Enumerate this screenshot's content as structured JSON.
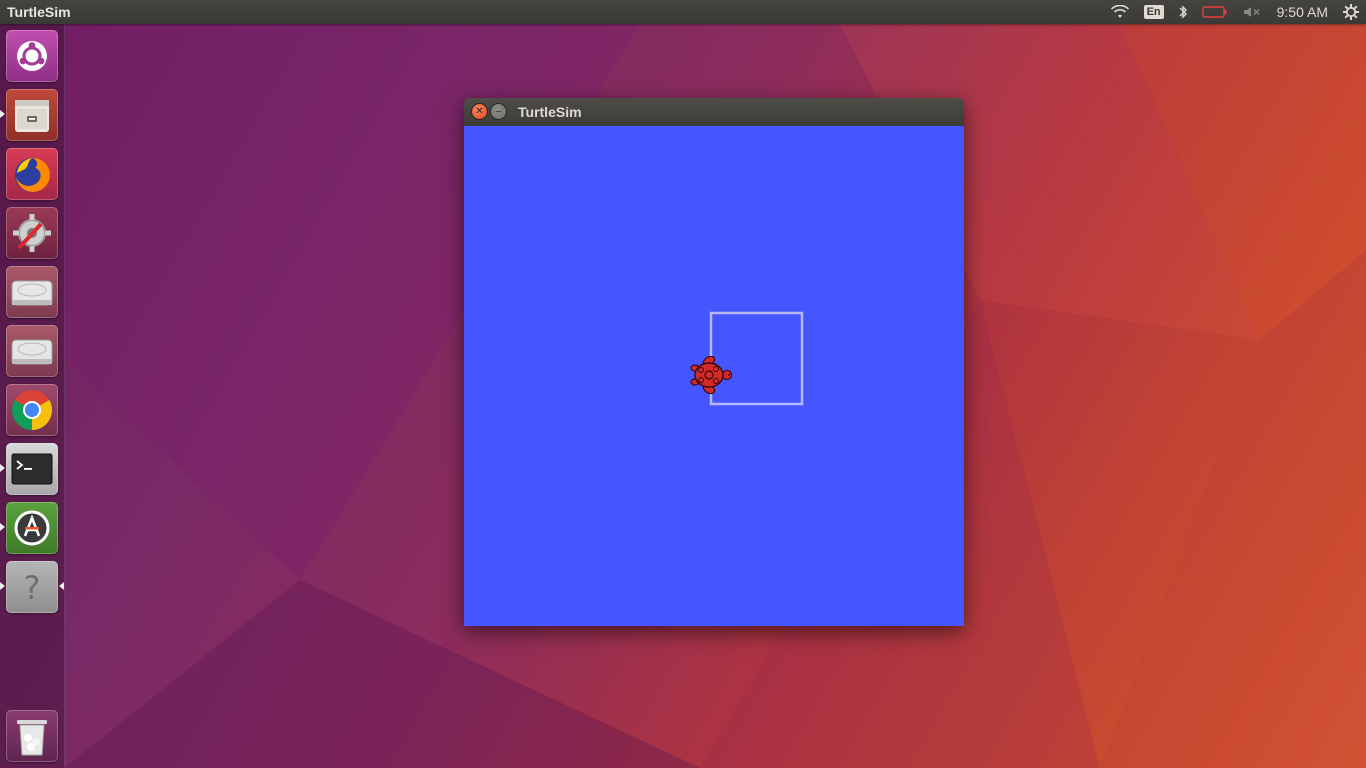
{
  "top_panel": {
    "app_title": "TurtleSim",
    "language": "En",
    "clock": "9:50 AM"
  },
  "launcher": {
    "items": [
      {
        "icon": "ubuntu-dash-icon"
      },
      {
        "icon": "files-icon"
      },
      {
        "icon": "firefox-icon"
      },
      {
        "icon": "system-settings-icon"
      },
      {
        "icon": "drive-icon"
      },
      {
        "icon": "drive-icon"
      },
      {
        "icon": "chrome-icon"
      },
      {
        "icon": "terminal-icon"
      },
      {
        "icon": "software-updater-icon"
      },
      {
        "icon": "help-icon"
      },
      {
        "icon": "trash-icon"
      }
    ]
  },
  "window": {
    "title": "TurtleSim",
    "canvas_color": "#4556ff",
    "pen_color": "#b3b8ff",
    "turtle_color": "#d42a2a"
  }
}
